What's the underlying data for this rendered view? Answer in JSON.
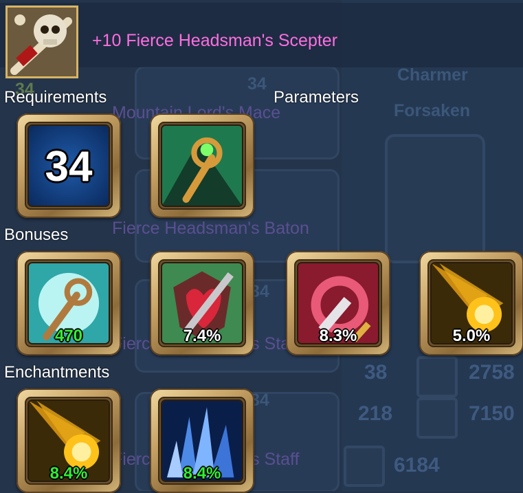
{
  "item": {
    "name": "+10 Fierce Headsman's Scepter",
    "icon": "skull-scepter-icon",
    "name_color": "#ff6ee0"
  },
  "sections": {
    "requirements": "Requirements",
    "parameters": "Parameters",
    "bonuses": "Bonuses",
    "enchantments": "Enchantments"
  },
  "requirements": {
    "level": "34",
    "class_icon": "staff-class-icon"
  },
  "bonuses": [
    {
      "icon": "frost-staff-icon",
      "value": "470",
      "color": "#33ee33"
    },
    {
      "icon": "sword-heart-icon",
      "value": "7.4%",
      "color": "#ffffff"
    },
    {
      "icon": "swirl-blade-icon",
      "value": "8.3%",
      "color": "#ffffff"
    },
    {
      "icon": "fire-orb-icon",
      "value": "5.0%",
      "color": "#ffffff"
    }
  ],
  "enchantments": [
    {
      "icon": "fire-orb-icon",
      "value": "8.4%",
      "color": "#33ee33"
    },
    {
      "icon": "ice-crystal-icon",
      "value": "8.4%",
      "color": "#33ee33"
    }
  ],
  "background": {
    "list_items": [
      "Mountain Lord's Mace",
      "Fierce Headsman's Baton",
      "Fierce Headsman's Staff",
      "Fierce Headsman's Staff"
    ],
    "right_titles": [
      "Charmer",
      "Forsaken"
    ],
    "level_labels": [
      "34",
      "34",
      "34",
      "34"
    ],
    "stats_left": [
      "38",
      "218"
    ],
    "stats_right": [
      "2758",
      "7150",
      "6184"
    ]
  }
}
